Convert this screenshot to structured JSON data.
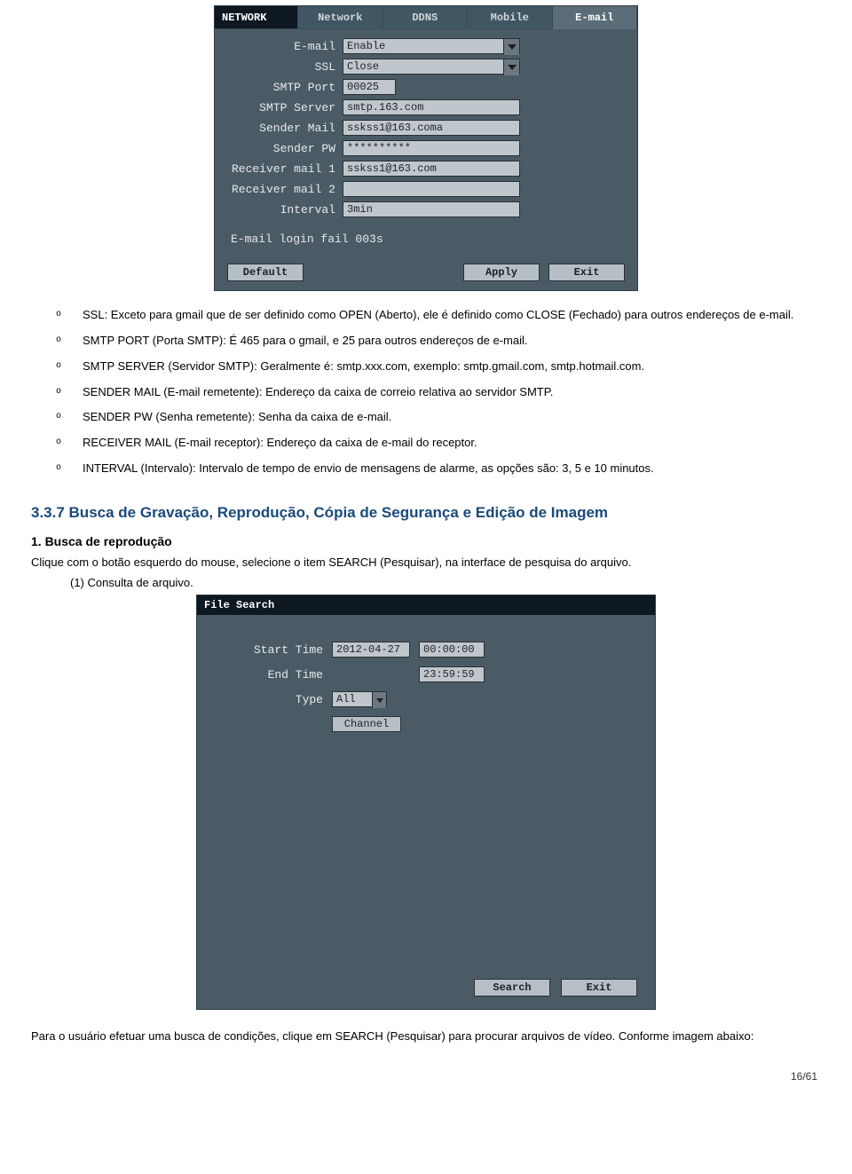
{
  "net": {
    "tabs": [
      "NETWORK",
      "Network",
      "DDNS",
      "Mobile",
      "E-mail"
    ],
    "fields": {
      "email_label": "E-mail",
      "email_value": "Enable",
      "ssl_label": "SSL",
      "ssl_value": "Close",
      "port_label": "SMTP Port",
      "port_value": "00025",
      "server_label": "SMTP Server",
      "server_value": "smtp.163.com",
      "sender_label": "Sender Mail",
      "sender_value": "sskss1@163.coma",
      "pw_label": "Sender PW",
      "pw_value": "**********",
      "rx1_label": "Receiver mail 1",
      "rx1_value": "sskss1@163.com",
      "rx2_label": "Receiver mail 2",
      "rx2_value": "",
      "interval_label": "Interval",
      "interval_value": "3min"
    },
    "status": "E-mail login fail  003s",
    "buttons": {
      "default": "Default",
      "apply": "Apply",
      "exit": "Exit"
    }
  },
  "bullets": {
    "b1": "SSL: Exceto para gmail que de ser definido como OPEN (Aberto), ele é definido como CLOSE (Fechado) para outros endereços de e-mail.",
    "b2": "SMTP PORT (Porta SMTP): É 465 para o gmail, e 25 para outros endereços de e-mail.",
    "b3": "SMTP SERVER (Servidor SMTP): Geralmente é: smtp.xxx.com, exemplo: smtp.gmail.com, smtp.hotmail.com.",
    "b4": "SENDER MAIL (E-mail remetente): Endereço da caixa de correio relativa ao servidor SMTP.",
    "b5": "SENDER PW (Senha remetente): Senha da caixa de e-mail.",
    "b6": "RECEIVER MAIL (E-mail receptor): Endereço da caixa de e-mail do receptor.",
    "b7": "INTERVAL (Intervalo): Intervalo de tempo de envio de mensagens de alarme, as opções são: 3, 5 e 10 minutos."
  },
  "section": {
    "heading": "3.3.7  Busca de Gravação, Reprodução, Cópia de Segurança e Edição de Imagem",
    "sub_num": "1.   Busca de reprodução",
    "lead": "Clique com o botão esquerdo do mouse, selecione o item SEARCH (Pesquisar), na interface de pesquisa do arquivo.",
    "enum": "(1)    Consulta de arquivo."
  },
  "fs": {
    "title": "File Search",
    "start_label": "Start Time",
    "start_date": "2012-04-27",
    "start_time": "00:00:00",
    "end_label": "End Time",
    "end_time": "23:59:59",
    "type_label": "Type",
    "type_value": "All",
    "channel_label": "Channel",
    "buttons": {
      "search": "Search",
      "exit": "Exit"
    }
  },
  "tail": "Para o usuário efetuar uma busca de condições, clique em SEARCH (Pesquisar) para procurar arquivos de vídeo. Conforme imagem abaixo:",
  "pager": "16/61"
}
